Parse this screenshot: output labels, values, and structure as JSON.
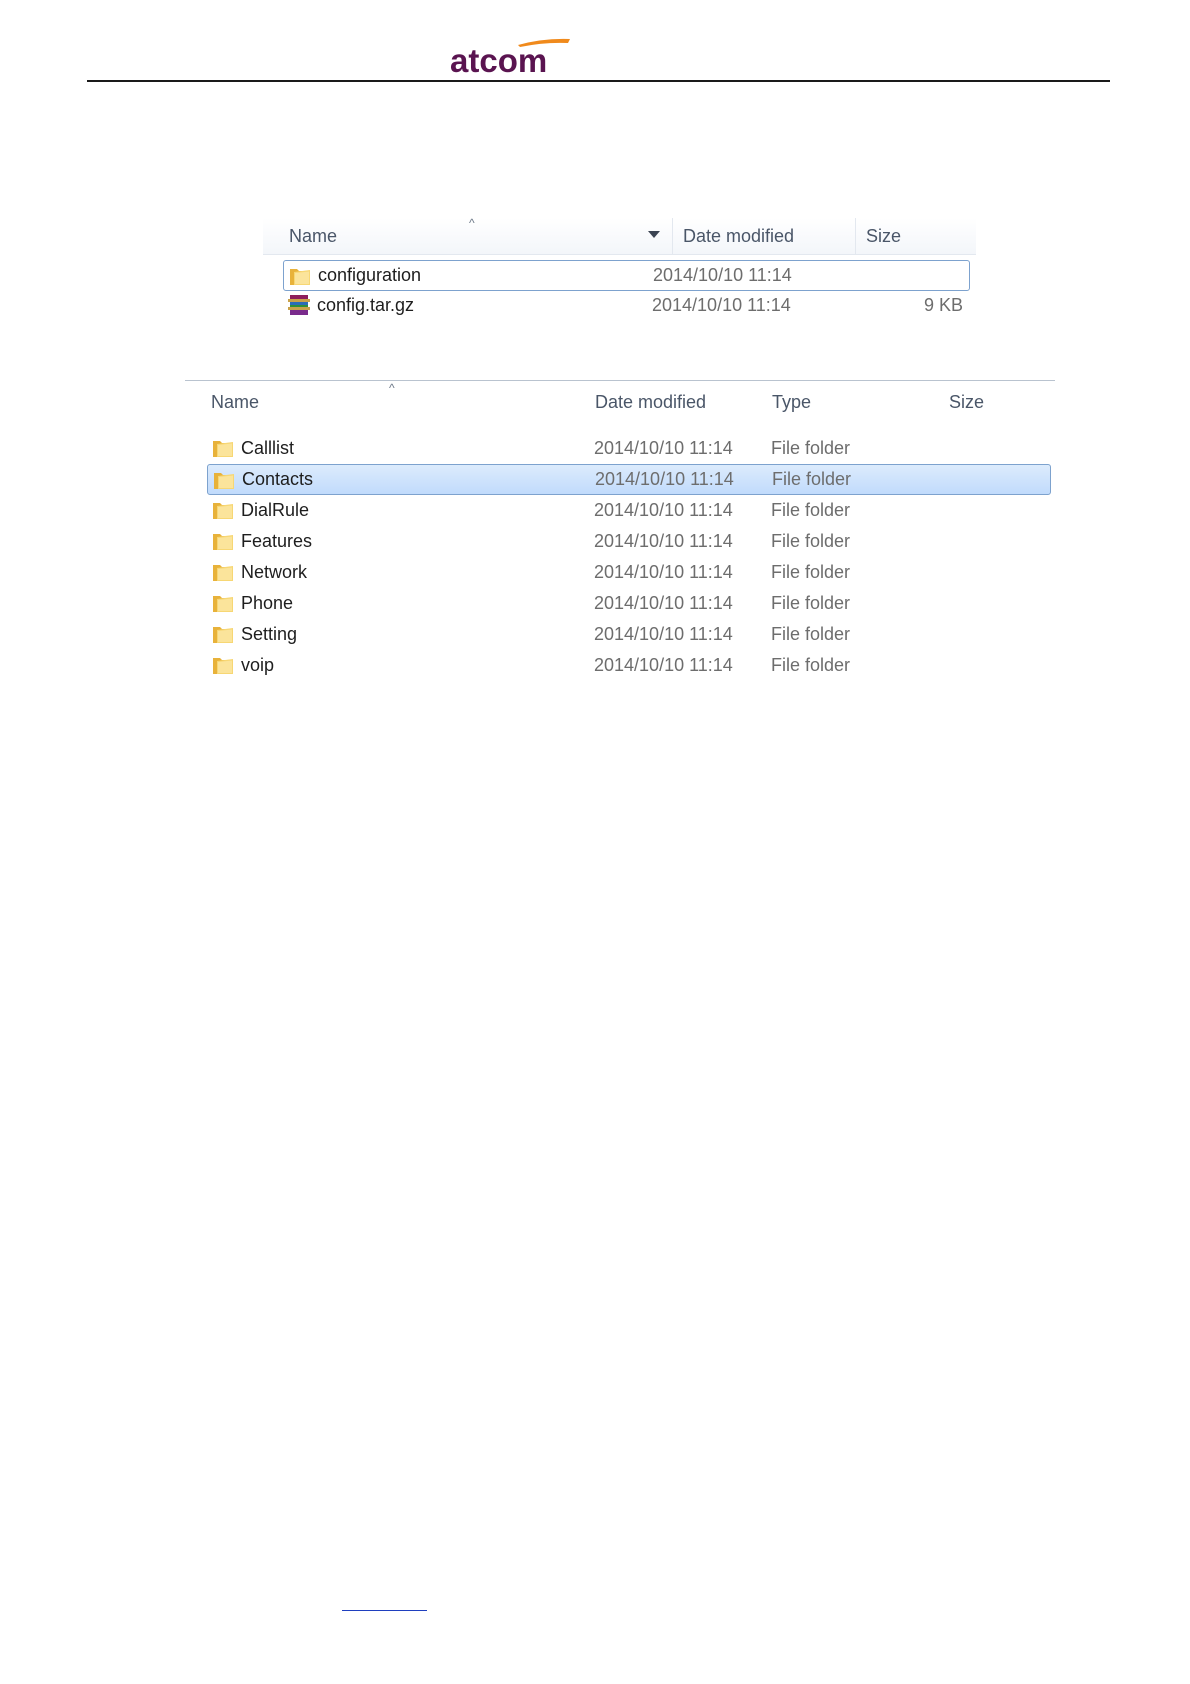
{
  "header": {
    "logo_text": "atcom",
    "colors": {
      "logo_text": "#5a1450",
      "logo_swoosh": "#f08a1c"
    }
  },
  "explorer_top": {
    "columns": {
      "name": "Name",
      "date_modified": "Date modified",
      "size": "Size"
    },
    "rows": [
      {
        "name": "configuration",
        "date": "2014/10/10 11:14",
        "size": "",
        "icon": "folder-icon",
        "state": "selected-outline"
      },
      {
        "name": "config.tar.gz",
        "date": "2014/10/10 11:14",
        "size": "9 KB",
        "icon": "archive-icon",
        "state": "normal"
      }
    ]
  },
  "explorer_bottom": {
    "columns": {
      "name": "Name",
      "date_modified": "Date modified",
      "type": "Type",
      "size": "Size"
    },
    "rows": [
      {
        "name": "Calllist",
        "date": "2014/10/10 11:14",
        "type": "File folder",
        "icon": "folder-icon"
      },
      {
        "name": "Contacts",
        "date": "2014/10/10 11:14",
        "type": "File folder",
        "icon": "folder-icon",
        "selected": true
      },
      {
        "name": "DialRule",
        "date": "2014/10/10 11:14",
        "type": "File folder",
        "icon": "folder-icon"
      },
      {
        "name": "Features",
        "date": "2014/10/10 11:14",
        "type": "File folder",
        "icon": "folder-icon"
      },
      {
        "name": "Network",
        "date": "2014/10/10 11:14",
        "type": "File folder",
        "icon": "folder-icon"
      },
      {
        "name": "Phone",
        "date": "2014/10/10 11:14",
        "type": "File folder",
        "icon": "folder-icon"
      },
      {
        "name": "Setting",
        "date": "2014/10/10 11:14",
        "type": "File folder",
        "icon": "folder-icon"
      },
      {
        "name": "voip",
        "date": "2014/10/10 11:14",
        "type": "File folder",
        "icon": "folder-icon"
      }
    ]
  },
  "colors": {
    "selection_border": "#7da2ce",
    "selection_fill": "#c9e0fc",
    "header_text": "#4a5668",
    "secondary_text": "#6d6d6d",
    "folder": "#f2c94c"
  }
}
